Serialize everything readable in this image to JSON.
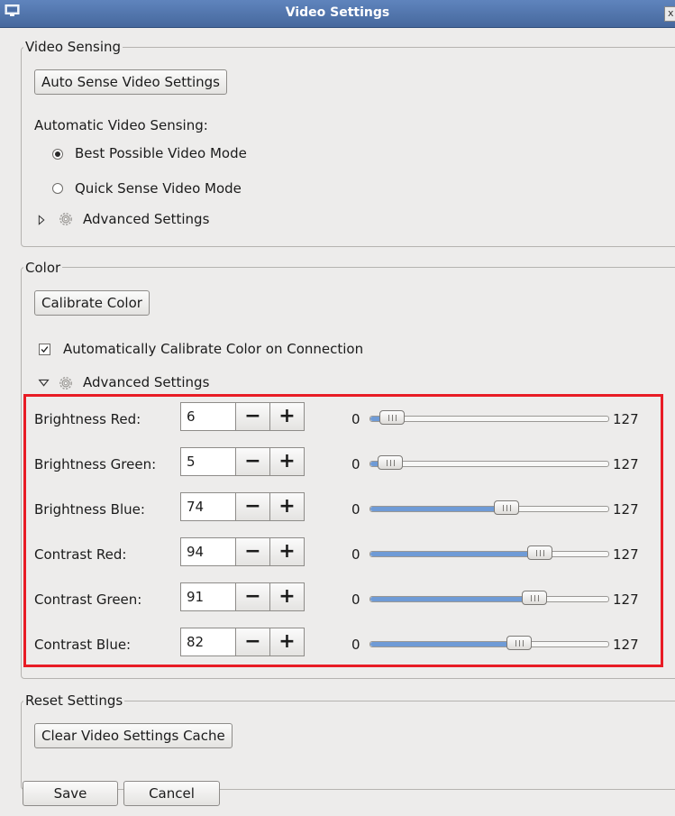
{
  "window": {
    "title": "Video Settings",
    "title_icon": "monitor-icon",
    "close_icon": "close-icon",
    "close_glyph": "x"
  },
  "video_sensing": {
    "legend": "Video Sensing",
    "auto_sense_button": "Auto Sense Video Settings",
    "automatic_label": "Automatic Video Sensing:",
    "options": [
      {
        "label": "Best Possible Video Mode",
        "selected": true
      },
      {
        "label": "Quick Sense Video Mode",
        "selected": false
      }
    ],
    "advanced": {
      "label": "Advanced Settings",
      "expanded": false,
      "icon": "gear-icon"
    }
  },
  "color": {
    "legend": "Color",
    "calibrate_button": "Calibrate Color",
    "auto_calibrate": {
      "label": "Automatically Calibrate Color on Connection",
      "checked": true
    },
    "advanced": {
      "label": "Advanced Settings",
      "expanded": true,
      "icon": "gear-icon"
    },
    "settings": [
      {
        "label": "Brightness Red:",
        "value": "6",
        "min": "0",
        "max": "127",
        "level": 6
      },
      {
        "label": "Brightness Green:",
        "value": "5",
        "min": "0",
        "max": "127",
        "level": 5
      },
      {
        "label": "Brightness Blue:",
        "value": "74",
        "min": "0",
        "max": "127",
        "level": 74
      },
      {
        "label": "Contrast Red:",
        "value": "94",
        "min": "0",
        "max": "127",
        "level": 94
      },
      {
        "label": "Contrast Green:",
        "value": "91",
        "min": "0",
        "max": "127",
        "level": 91
      },
      {
        "label": "Contrast Blue:",
        "value": "82",
        "min": "0",
        "max": "127",
        "level": 82
      }
    ],
    "spin_minus": "−",
    "spin_plus": "+"
  },
  "reset": {
    "legend": "Reset Settings",
    "clear_cache_button": "Clear Video Settings Cache"
  },
  "footer": {
    "save_label": "Save",
    "cancel_label": "Cancel"
  },
  "colors": {
    "titlebar": "#5274aa",
    "highlight": "#e81c25",
    "slider_fill": "#6f9bd6"
  }
}
